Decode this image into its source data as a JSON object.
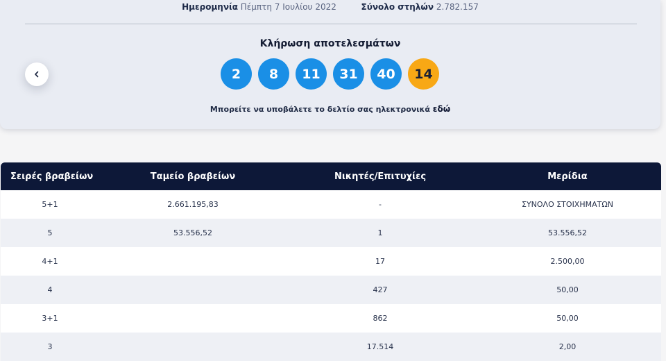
{
  "meta": {
    "date_label": "Ημερομηνία",
    "date_value": "Πέμπτη 7 Ιουλίου 2022",
    "columns_label": "Σύνολο στηλών",
    "columns_value": "2.782.157"
  },
  "draw": {
    "title": "Κλήρωση αποτελεσμάτων",
    "numbers": [
      "2",
      "8",
      "11",
      "31",
      "40"
    ],
    "bonus": "14",
    "submit_text": "Μπορείτε να υποβάλετε το δελτίο σας ηλεκτρονικά",
    "submit_link": "εδώ"
  },
  "table": {
    "headers": [
      "Σειρές βραβείων",
      "Ταμείο βραβείων",
      "Νικητές/Επιτυχίες",
      "Μερίδια"
    ],
    "rows": [
      [
        "5+1",
        "2.661.195,83",
        "-",
        "ΣΥΝΟΛΟ ΣΤΟΙΧΗΜΑΤΩΝ"
      ],
      [
        "5",
        "53.556,52",
        "1",
        "53.556,52"
      ],
      [
        "4+1",
        "",
        "17",
        "2.500,00"
      ],
      [
        "4",
        "",
        "427",
        "50,00"
      ],
      [
        "3+1",
        "",
        "862",
        "50,00"
      ],
      [
        "3",
        "",
        "17.514",
        "2,00"
      ]
    ]
  },
  "icons": {
    "prev": "chevron-left-icon"
  }
}
